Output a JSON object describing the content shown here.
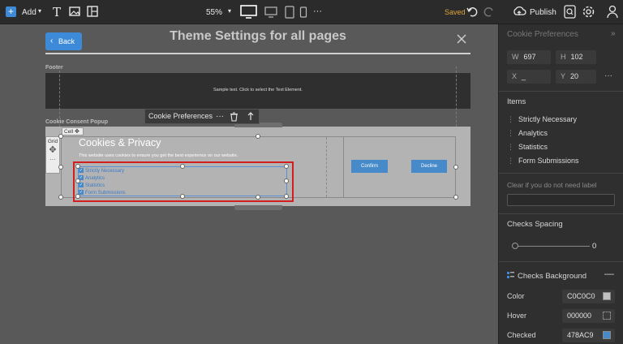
{
  "toolbar": {
    "add_label": "Add",
    "zoom": "55%",
    "saved_label": "Saved",
    "publish_label": "Publish",
    "more_label": "···"
  },
  "header": {
    "back_label": "Back",
    "title": "Theme Settings for all pages"
  },
  "canvas": {
    "footer_label": "Footer",
    "footer_text": "Sample text. Click to select the Text Element.",
    "consent_label": "Cookie Consent Popup",
    "cell_label": "Cell",
    "grid_label": "Grid",
    "context_bar_label": "Cookie Preferences",
    "popup_title": "Cookies & Privacy",
    "popup_text": "This website uses cookies to ensure you get the best experience on our website.",
    "checks": [
      "Strictly Necessary",
      "Analytics",
      "Statistics",
      "Form Submissions"
    ],
    "confirm_label": "Confirm",
    "decline_label": "Decline"
  },
  "panel": {
    "title": "Cookie Preferences",
    "w_label": "W",
    "w_value": "697",
    "h_label": "H",
    "h_value": "102",
    "x_label": "X",
    "x_value": "_",
    "y_label": "Y",
    "y_value": "20",
    "items_label": "Items",
    "items": [
      "Strictly Necessary",
      "Analytics",
      "Statistics",
      "Form Submissions"
    ],
    "clear_label": "Clear if you do not need label",
    "spacing_label": "Checks Spacing",
    "spacing_value": "0",
    "spacing_fraction": 0,
    "bg_label": "Checks Background",
    "color_label": "Color",
    "color_value": "C0C0C0",
    "color_hex": "#C0C0C0",
    "hover_label": "Hover",
    "hover_value": "000000",
    "hover_hex": "#000000",
    "checked_label": "Checked",
    "checked_value": "478AC9",
    "checked_hex": "#478AC9"
  }
}
